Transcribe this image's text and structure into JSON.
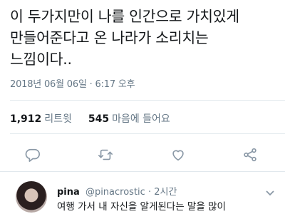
{
  "tweet": {
    "lines": [
      "이 두가지만이 나를 인간으로 가치있게",
      "만들어준다고 온 나라가 소리치는",
      "느낌이다.."
    ],
    "timestamp": "2018년 06월 06일 · 6:17 오후"
  },
  "stats": {
    "retweets_count": "1,912",
    "retweets_label": "리트윗",
    "likes_count": "545",
    "likes_label": "마음에 들어요"
  },
  "actions": [
    "reply-icon",
    "retweet-icon",
    "like-icon",
    "share-icon"
  ],
  "reply": {
    "name": "pina",
    "handle": "@pinacrostic",
    "separator": "·",
    "time": "2시간",
    "text": "여행 가서 내 자신을 알게된다는 말을 많이"
  },
  "colors": {
    "text": "#14171a",
    "secondary": "#657786",
    "icon": "#8a98a6",
    "divider": "#e1e8ed"
  }
}
